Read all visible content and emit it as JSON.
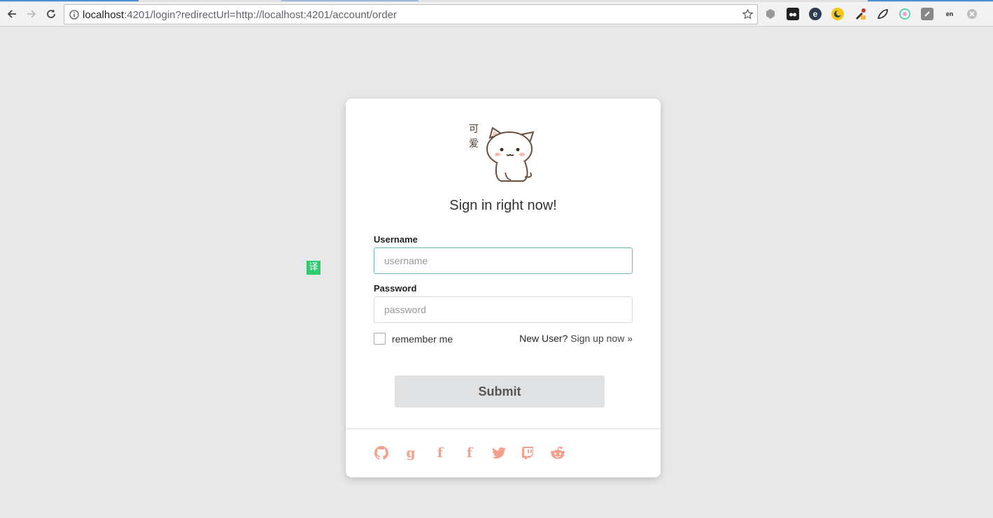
{
  "browser": {
    "url_host": "localhost",
    "url_rest": ":4201/login?redirectUrl=http://localhost:4201/account/order"
  },
  "translate": {
    "label": "译"
  },
  "login": {
    "mascot_caption": [
      "可",
      "爱"
    ],
    "title": "Sign in right now!",
    "username_label": "Username",
    "username_placeholder": "username",
    "password_label": "Password",
    "password_placeholder": "password",
    "remember_label": "remember me",
    "new_user_text": "New User?",
    "signup_link": "Sign up now »",
    "submit_label": "Submit",
    "social_icons": [
      "github-icon",
      "google-icon",
      "facebook-icon",
      "facebook-icon",
      "twitter-icon",
      "twitch-icon",
      "reddit-icon"
    ],
    "social_color": "#f4a08c"
  }
}
